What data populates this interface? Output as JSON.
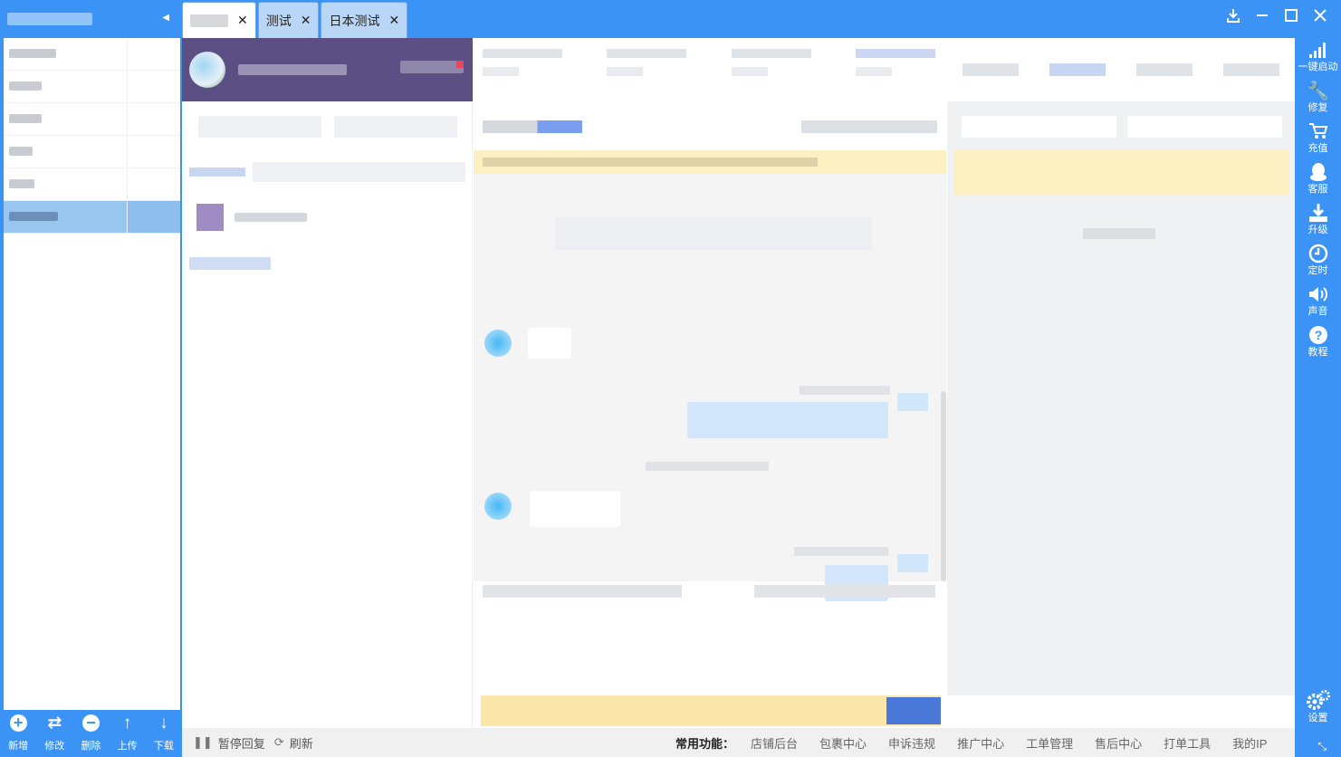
{
  "tabs": [
    {
      "label": "",
      "active": true
    },
    {
      "label": "测试",
      "active": false
    },
    {
      "label": "日本测试",
      "active": false
    }
  ],
  "tab_close_glyph": "✕",
  "window_controls": [
    "download-icon",
    "minimize-icon",
    "maximize-icon",
    "close-icon"
  ],
  "left_toolbar": {
    "add": "新增",
    "edit": "修改",
    "delete": "删除",
    "upload": "上传",
    "download": "下载"
  },
  "right_toolbar": {
    "one_click_start": "一键启动",
    "repair": "修复",
    "recharge": "充值",
    "customer_service": "客服",
    "upgrade": "升级",
    "timer": "定时",
    "sound": "声音",
    "tutorial": "教程",
    "settings": "设置"
  },
  "status_bar": {
    "pause_reply": "暂停回复",
    "refresh": "刷新",
    "common_functions_label": "常用功能：",
    "links": [
      "店铺后台",
      "包裹中心",
      "申诉违规",
      "推广中心",
      "工单管理",
      "售后中心",
      "打单工具",
      "我的IP"
    ]
  },
  "colors": {
    "brand_blue": "#3a93f5",
    "store_card": "#5b4f83",
    "notice_yellow": "#fcefc2",
    "selected_row": "#99c6ee"
  },
  "account_rows": 6,
  "selected_account_index": 5
}
